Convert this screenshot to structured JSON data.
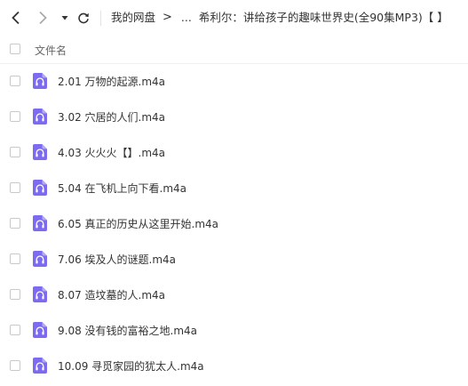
{
  "colors": {
    "audio_icon_bg": "#7c6bf0",
    "text": "#333333",
    "muted_text": "#666666"
  },
  "toolbar": {
    "back_icon": "chevron-left-icon",
    "forward_icon": "chevron-right-icon",
    "history_icon": "caret-down-icon",
    "refresh_icon": "refresh-icon"
  },
  "breadcrumb": {
    "root": "我的网盘",
    "arrow": ">",
    "ellipsis": "...",
    "current": "希利尔：讲给孩子的趣味世界史(全90集MP3)【 】"
  },
  "list_header": {
    "name_label": "文件名"
  },
  "files": [
    {
      "name": "2.01 万物的起源.m4a",
      "icon": "audio-file-icon"
    },
    {
      "name": "3.02 穴居的人们.m4a",
      "icon": "audio-file-icon"
    },
    {
      "name": "4.03 火火火【】.m4a",
      "icon": "audio-file-icon"
    },
    {
      "name": "5.04 在飞机上向下看.m4a",
      "icon": "audio-file-icon"
    },
    {
      "name": "6.05 真正的历史从这里开始.m4a",
      "icon": "audio-file-icon"
    },
    {
      "name": "7.06 埃及人的谜题.m4a",
      "icon": "audio-file-icon"
    },
    {
      "name": "8.07 造坟墓的人.m4a",
      "icon": "audio-file-icon"
    },
    {
      "name": "9.08 没有钱的富裕之地.m4a",
      "icon": "audio-file-icon"
    },
    {
      "name": "10.09 寻觅家园的犹太人.m4a",
      "icon": "audio-file-icon"
    }
  ]
}
